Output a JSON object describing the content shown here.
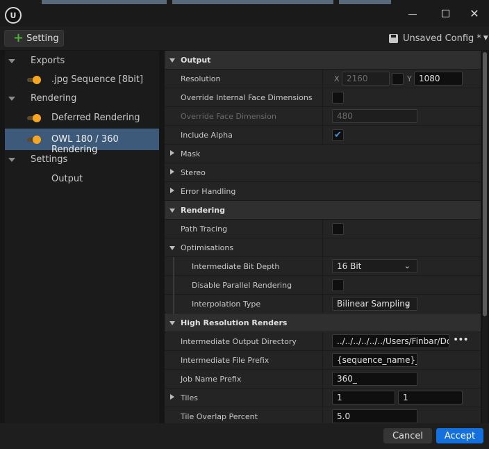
{
  "titlebar": {
    "min_label": "",
    "max_label": "",
    "close_label": "✕"
  },
  "toolbar": {
    "setting_label": "Setting",
    "config_label": "Unsaved Config *"
  },
  "tree": [
    {
      "label": "Exports",
      "kind": "group"
    },
    {
      "label": ".jpg Sequence [8bit]",
      "kind": "item"
    },
    {
      "label": "Rendering",
      "kind": "group"
    },
    {
      "label": "Deferred Rendering",
      "kind": "item"
    },
    {
      "label": "OWL 180 / 360 Rendering",
      "kind": "item",
      "selected": true
    },
    {
      "label": "Settings",
      "kind": "group"
    },
    {
      "label": "Output",
      "kind": "plain"
    }
  ],
  "props": {
    "output": "Output",
    "resolution": {
      "label": "Resolution",
      "x_label": "X",
      "x_value": "2160",
      "y_label": "Y",
      "y_value": "1080"
    },
    "override_internal": {
      "label": "Override Internal Face Dimensions",
      "checked": false
    },
    "override_face": {
      "label": "Override Face Dimension",
      "value": "480"
    },
    "include_alpha": {
      "label": "Include Alpha",
      "checked": true,
      "check": "✔"
    },
    "mask": "Mask",
    "stereo": "Stereo",
    "error_handling": "Error Handling",
    "rendering": "Rendering",
    "path_tracing": {
      "label": "Path Tracing",
      "checked": false
    },
    "optimisations": "Optimisations",
    "bit_depth": {
      "label": "Intermediate Bit Depth",
      "value": "16 Bit"
    },
    "disable_parallel": {
      "label": "Disable Parallel Rendering",
      "checked": false
    },
    "interp": {
      "label": "Interpolation Type",
      "value": "Bilinear Sampling"
    },
    "high_res": "High Resolution Renders",
    "out_dir": {
      "label": "Intermediate Output Directory",
      "value": "../../../../../../Users/Finbar/Do",
      "more": "•••"
    },
    "file_prefix": {
      "label": "Intermediate File Prefix",
      "value": "{sequence_name}_"
    },
    "job_prefix": {
      "label": "Job Name Prefix",
      "value": "360_"
    },
    "tiles": {
      "label": "Tiles",
      "x": "1",
      "y": "1"
    },
    "overlap": {
      "label": "Tile Overlap Percent",
      "value": "5.0"
    }
  },
  "footer": {
    "cancel_label": "Cancel",
    "accept_label": "Accept"
  },
  "colors": {
    "accent": "#1470dc",
    "selected": "#3d5a7a",
    "toggle": "#f5a623",
    "plus": "#4caf3a"
  }
}
